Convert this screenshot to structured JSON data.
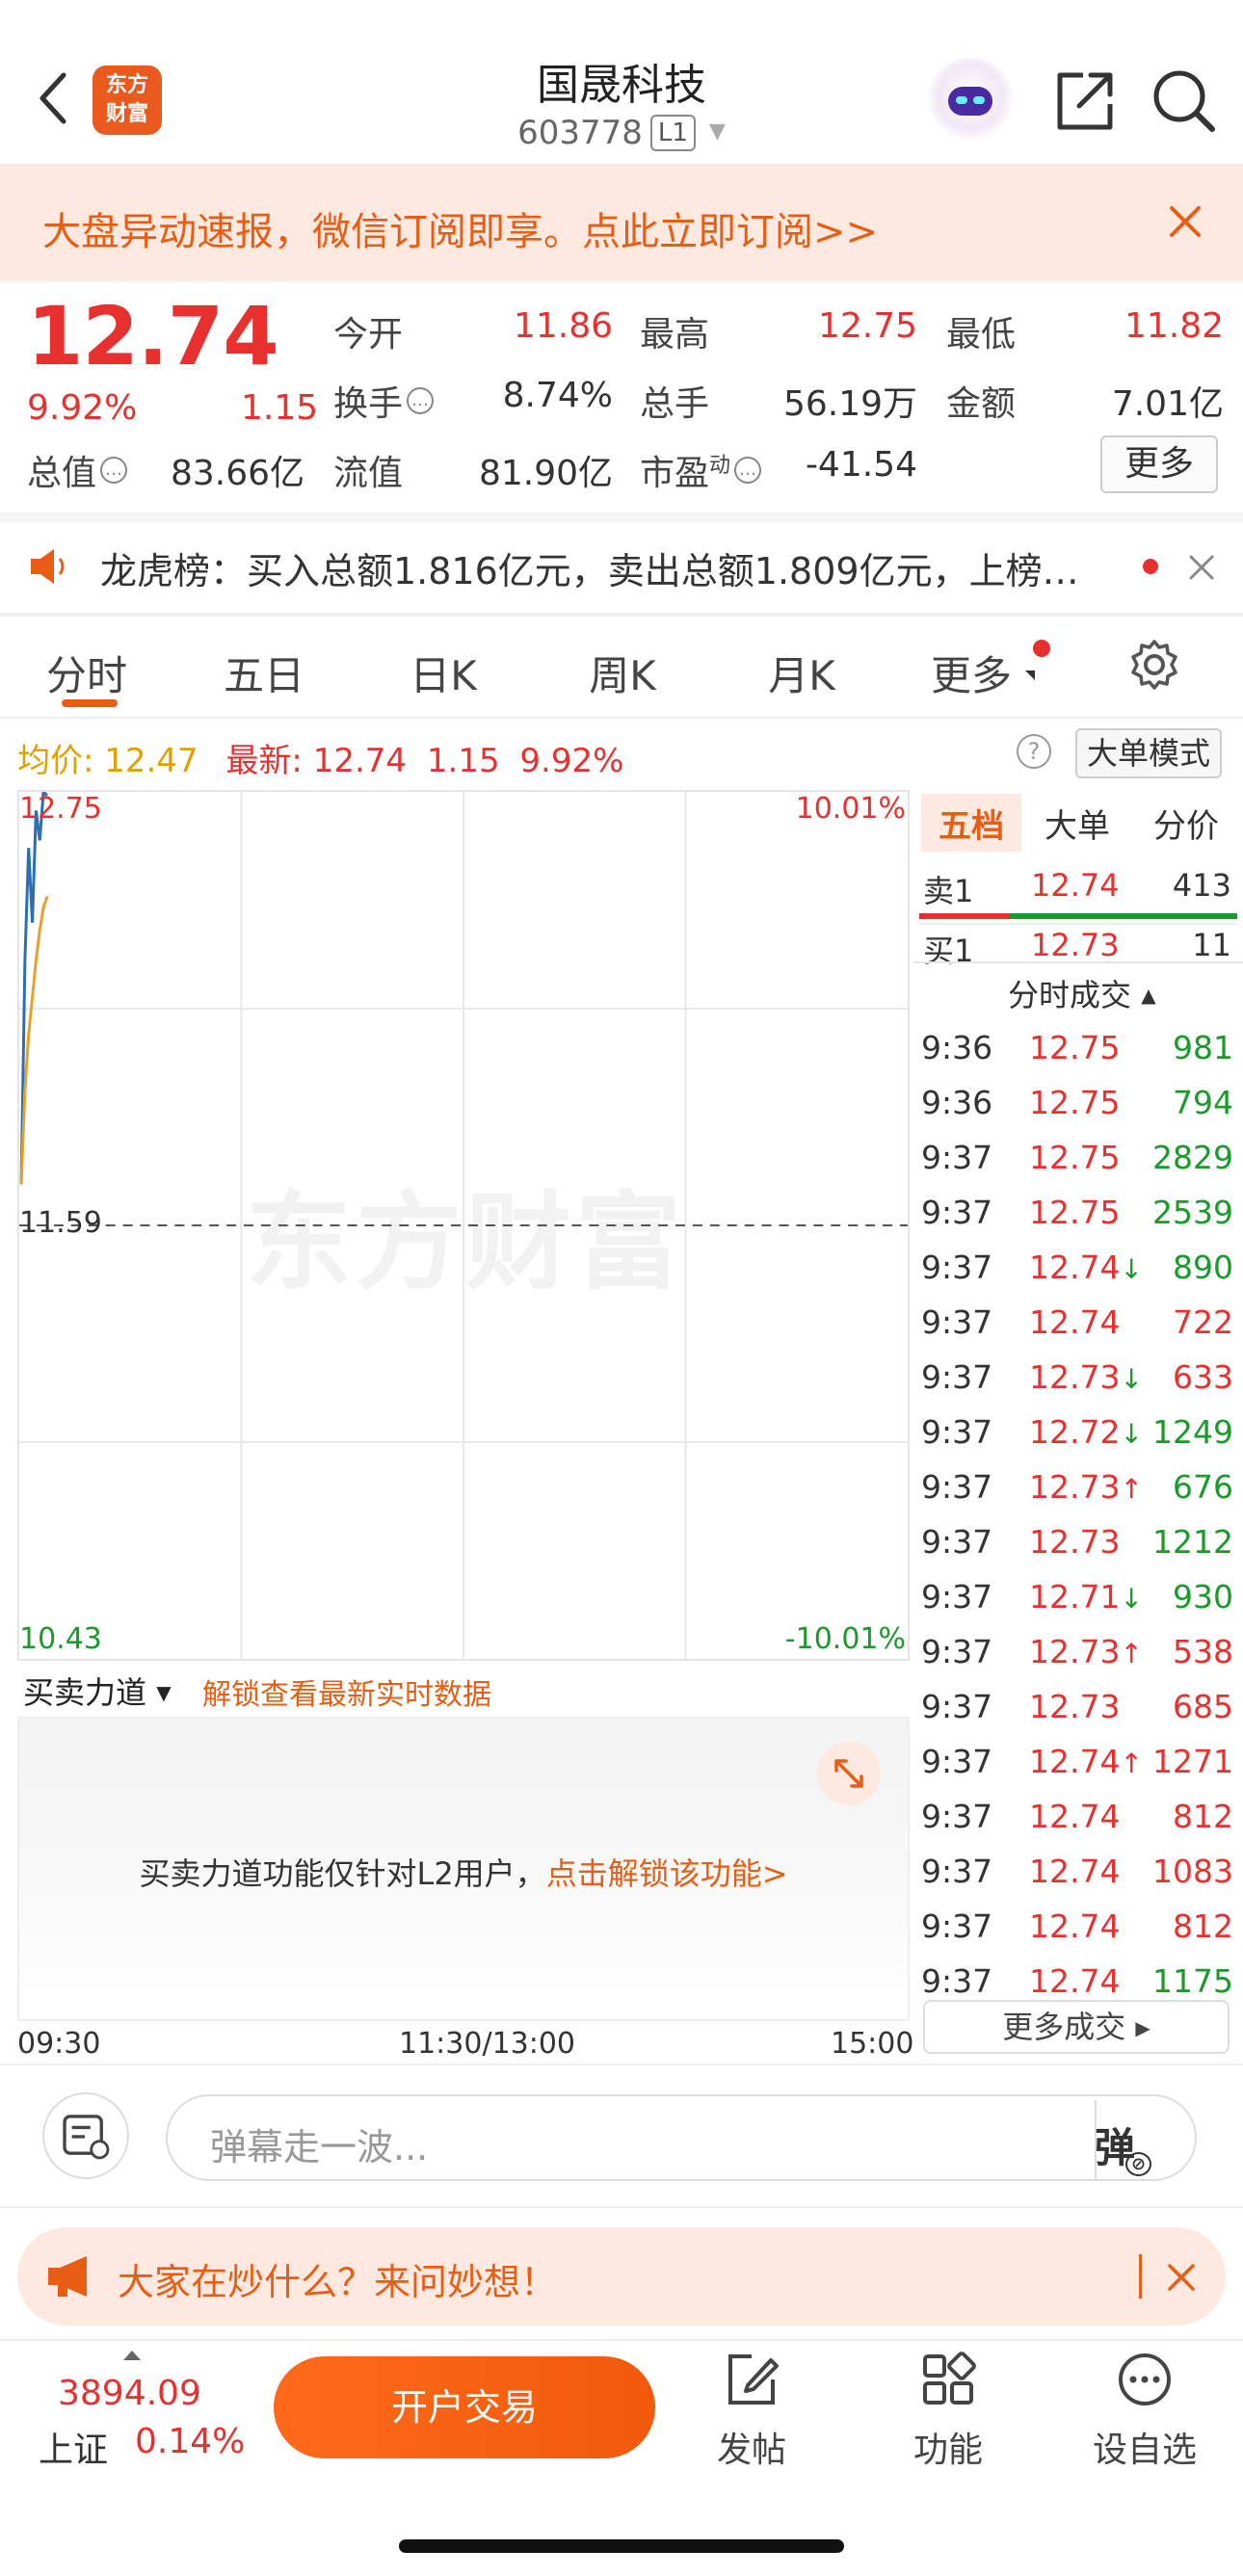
{
  "header": {
    "title": "国晟科技",
    "code": "603778",
    "level_badge": "L1",
    "logo_line1": "东方",
    "logo_line2": "财富"
  },
  "banner": {
    "text": "大盘异动速报，微信订阅即享。点此立即订阅>>"
  },
  "quote": {
    "price": "12.74",
    "change_pct": "9.92%",
    "change": "1.15",
    "open_label": "今开",
    "open": "11.86",
    "high_label": "最高",
    "high": "12.75",
    "low_label": "最低",
    "low": "11.82",
    "turnover_label": "换手",
    "turnover": "8.74%",
    "volume_label": "总手",
    "volume": "56.19万",
    "amount_label": "金额",
    "amount": "7.01亿",
    "mktcap_label": "总值",
    "mktcap": "83.66亿",
    "float_label": "流值",
    "float": "81.90亿",
    "pe_label": "市盈",
    "pe_sup": "动",
    "pe": "-41.54",
    "more_label": "更多"
  },
  "dragon": {
    "text": "龙虎榜：买入总额1.816亿元，卖出总额1.809亿元，上榜…"
  },
  "tabs": [
    {
      "label": "分时",
      "active": true
    },
    {
      "label": "五日"
    },
    {
      "label": "日K"
    },
    {
      "label": "周K"
    },
    {
      "label": "月K"
    },
    {
      "label": "更多"
    }
  ],
  "avg_row": {
    "avg_label": "均价:",
    "avg_value": "12.47",
    "latest_label": "最新:",
    "latest_value": "12.74",
    "change": "1.15",
    "pct": "9.92%",
    "big_order_label": "大单模式",
    "help": "?"
  },
  "chart_data": {
    "type": "line",
    "top_price": "12.75",
    "mid_price": "11.59",
    "bottom_price": "10.43",
    "top_pct": "10.01%",
    "bottom_pct": "-10.01%",
    "price_range": [
      10.43,
      12.75
    ],
    "prev_close": 11.59,
    "series": [
      {
        "color": "#2a6fb6",
        "x": [
          0,
          1,
          2,
          3,
          4,
          5,
          6,
          7
        ],
        "y": [
          11.7,
          12.3,
          12.6,
          12.4,
          12.7,
          12.62,
          12.75,
          12.74
        ]
      },
      {
        "color": "#e8a02a",
        "x": [
          0,
          1,
          2,
          3,
          4,
          5,
          6,
          7
        ],
        "y": [
          11.7,
          11.95,
          12.1,
          12.2,
          12.3,
          12.38,
          12.44,
          12.47
        ]
      }
    ],
    "minutes_total": 240,
    "minutes_elapsed": 7,
    "grid": true,
    "time_labels": [
      "09:30",
      "11:30/13:00",
      "15:00"
    ]
  },
  "watermark": "东方财富",
  "force": {
    "label": "买卖力道",
    "unlock_link": "解锁查看最新实时数据",
    "panel_text": "买卖力道功能仅针对L2用户，",
    "panel_link": "点击解锁该功能>"
  },
  "orderbook": {
    "tabs": [
      "五档",
      "大单",
      "分价"
    ],
    "sell_label": "卖1",
    "sell_price": "12.74",
    "sell_vol": "413",
    "buy_label": "买1",
    "buy_price": "12.73",
    "buy_vol": "11",
    "ticks_header": "分时成交",
    "ticks": [
      {
        "time": "9:36",
        "price": "12.75",
        "arrow": "",
        "vol": "981",
        "vol_color": "green"
      },
      {
        "time": "9:36",
        "price": "12.75",
        "arrow": "",
        "vol": "794",
        "vol_color": "green"
      },
      {
        "time": "9:37",
        "price": "12.75",
        "arrow": "",
        "vol": "2829",
        "vol_color": "green"
      },
      {
        "time": "9:37",
        "price": "12.75",
        "arrow": "",
        "vol": "2539",
        "vol_color": "green"
      },
      {
        "time": "9:37",
        "price": "12.74",
        "arrow": "↓",
        "vol": "890",
        "vol_color": "green"
      },
      {
        "time": "9:37",
        "price": "12.74",
        "arrow": "",
        "vol": "722",
        "vol_color": "red"
      },
      {
        "time": "9:37",
        "price": "12.73",
        "arrow": "↓",
        "vol": "633",
        "vol_color": "red"
      },
      {
        "time": "9:37",
        "price": "12.72",
        "arrow": "↓",
        "vol": "1249",
        "vol_color": "green"
      },
      {
        "time": "9:37",
        "price": "12.73",
        "arrow": "↑",
        "vol": "676",
        "vol_color": "green"
      },
      {
        "time": "9:37",
        "price": "12.73",
        "arrow": "",
        "vol": "1212",
        "vol_color": "green"
      },
      {
        "time": "9:37",
        "price": "12.71",
        "arrow": "↓",
        "vol": "930",
        "vol_color": "green"
      },
      {
        "time": "9:37",
        "price": "12.73",
        "arrow": "↑",
        "vol": "538",
        "vol_color": "red"
      },
      {
        "time": "9:37",
        "price": "12.73",
        "arrow": "",
        "vol": "685",
        "vol_color": "red"
      },
      {
        "time": "9:37",
        "price": "12.74",
        "arrow": "↑",
        "vol": "1271",
        "vol_color": "red"
      },
      {
        "time": "9:37",
        "price": "12.74",
        "arrow": "",
        "vol": "812",
        "vol_color": "red"
      },
      {
        "time": "9:37",
        "price": "12.74",
        "arrow": "",
        "vol": "1083",
        "vol_color": "red"
      },
      {
        "time": "9:37",
        "price": "12.74",
        "arrow": "",
        "vol": "812",
        "vol_color": "red"
      },
      {
        "time": "9:37",
        "price": "12.74",
        "arrow": "",
        "vol": "1175",
        "vol_color": "green"
      }
    ],
    "more_trades": "更多成交"
  },
  "danmu": {
    "placeholder": "弹幕走一波...",
    "button": "弹"
  },
  "ask_banner": {
    "text": "大家在炒什么？来问妙想！"
  },
  "bottom_nav": {
    "index_value": "3894.09",
    "index_name": "上证",
    "index_pct": "0.14%",
    "trade_button": "开户交易",
    "items": [
      {
        "label": "发帖",
        "icon": "edit-icon"
      },
      {
        "label": "功能",
        "icon": "grid-icon"
      },
      {
        "label": "设自选",
        "icon": "more-dots-icon"
      }
    ]
  },
  "colors": {
    "up": "#e8312f",
    "down": "#1a9a2a",
    "accent": "#e85d13",
    "banner_bg": "#fde9e0"
  }
}
